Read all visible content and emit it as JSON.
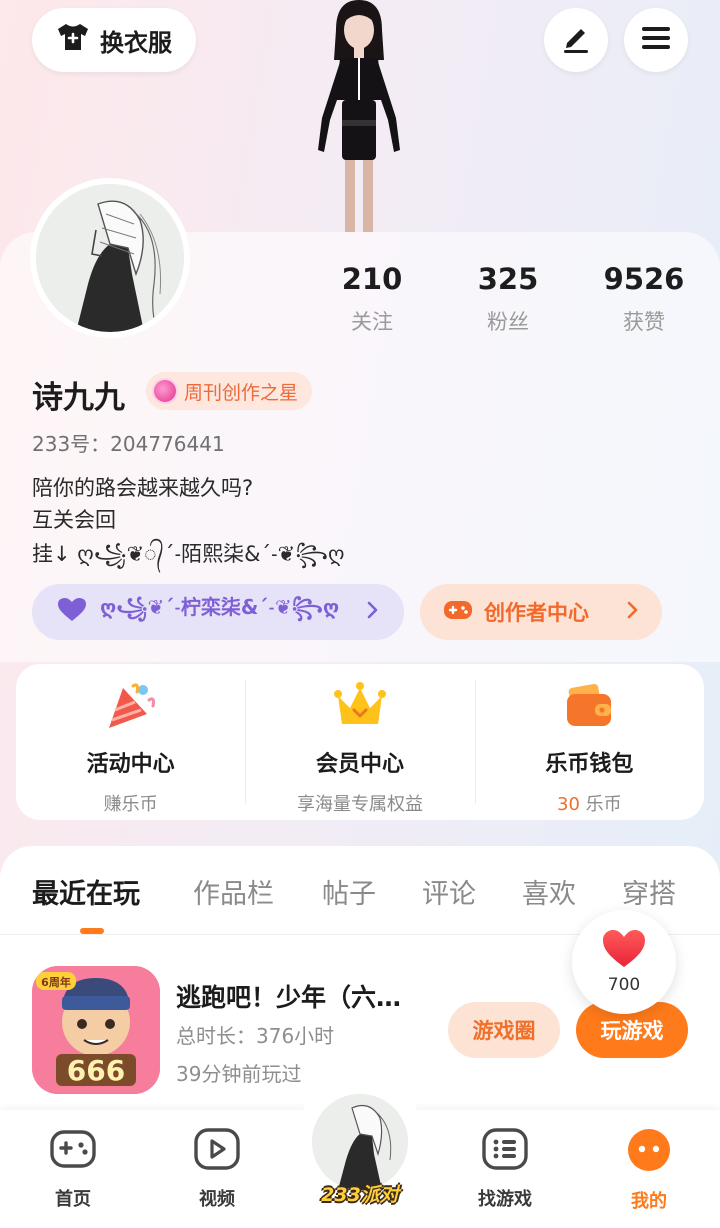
{
  "header": {
    "outfit_label": "换衣服"
  },
  "stats": [
    {
      "value": "210",
      "label": "关注"
    },
    {
      "value": "325",
      "label": "粉丝"
    },
    {
      "value": "9526",
      "label": "获赞"
    }
  ],
  "profile": {
    "name": "诗九九",
    "badge": "周刊创作之星",
    "uid": "233号：204776441",
    "bio_lines": [
      "陪你的路会越来越久吗?",
      "互关会回",
      "挂↓ ღ꧁❦᭄ˊ˗陌熙柒&ˊ˗❦꧂ღ"
    ]
  },
  "pills": {
    "friend_label": "ღ꧁❦ˊ˗柠栾柒&ˊ˗❦꧂ღ",
    "creator_label": "创作者中心"
  },
  "services": [
    {
      "title": "活动中心",
      "sub": "赚乐币"
    },
    {
      "title": "会员中心",
      "sub": "享海量专属权益"
    },
    {
      "title": "乐币钱包",
      "sub_value": "30",
      "sub_unit": "乐币"
    }
  ],
  "tabs": [
    "最近在玩",
    "作品栏",
    "帖子",
    "评论",
    "喜欢",
    "穿搭"
  ],
  "game": {
    "title": "逃跑吧！少年（六…",
    "playtime": "总时长：376小时",
    "last_played": "39分钟前玩过",
    "circle_label": "游戏圈",
    "play_label": "玩游戏",
    "icon_badge": "6周年",
    "icon_number": "666"
  },
  "like": {
    "count": "700"
  },
  "nav": {
    "items": [
      "首页",
      "视频",
      "找游戏",
      "我的"
    ],
    "center_label": "233派对"
  },
  "colors": {
    "accent": "#ff7a1a",
    "purple": "#7e5fd6"
  }
}
